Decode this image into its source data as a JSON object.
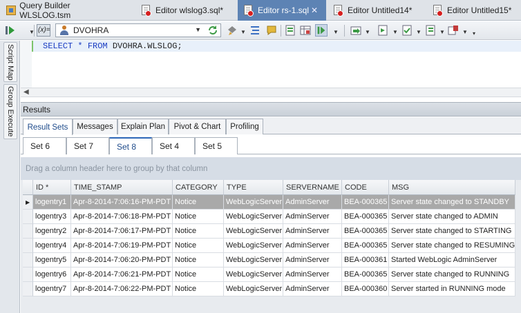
{
  "doc_tabs": [
    {
      "label": "Query Builder WLSLOG.tsm",
      "active": false
    },
    {
      "label": "Editor wlslog3.sql*",
      "active": false
    },
    {
      "label": "Editor rs-1.sql",
      "active": true
    },
    {
      "label": "Editor Untitled14*",
      "active": false
    },
    {
      "label": "Editor Untitled15*",
      "active": false
    }
  ],
  "toolbar": {
    "variables_label": "(x)=",
    "connection": "DVOHRA"
  },
  "side_panel": {
    "tabs": [
      "Script Map",
      "Group Execute"
    ]
  },
  "editor": {
    "sql_keyword_select": "SELECT",
    "sql_star": "*",
    "sql_keyword_from": "FROM",
    "sql_table": "DVOHRA.WLSLOG;"
  },
  "results": {
    "title": "Results",
    "tabs": [
      "Result Sets",
      "Messages",
      "Explain Plan",
      "Pivot & Chart",
      "Profiling"
    ],
    "active_tab": "Result Sets",
    "sets": [
      "Set 6",
      "Set 7",
      "Set 8",
      "Set 4",
      "Set 5"
    ],
    "active_set": "Set 8",
    "group_hint": "Drag a column header here to group by that column"
  },
  "grid": {
    "columns": [
      "ID *",
      "TIME_STAMP",
      "CATEGORY",
      "TYPE",
      "SERVERNAME",
      "CODE",
      "MSG"
    ],
    "rows": [
      [
        "logentry1",
        "Apr-8-2014-7:06:16-PM-PDT",
        "Notice",
        "WebLogicServer",
        "AdminServer",
        "BEA-000365",
        "Server state changed to STANDBY"
      ],
      [
        "logentry3",
        "Apr-8-2014-7:06:18-PM-PDT",
        "Notice",
        "WebLogicServer",
        "AdminServer",
        "BEA-000365",
        "Server state changed to ADMIN"
      ],
      [
        "logentry2",
        "Apr-8-2014-7:06:17-PM-PDT",
        "Notice",
        "WebLogicServer",
        "AdminServer",
        "BEA-000365",
        "Server state changed to STARTING"
      ],
      [
        "logentry4",
        "Apr-8-2014-7:06:19-PM-PDT",
        "Notice",
        "WebLogicServer",
        "AdminServer",
        "BEA-000365",
        "Server state changed to RESUMING"
      ],
      [
        "logentry5",
        "Apr-8-2014-7:06:20-PM-PDT",
        "Notice",
        "WebLogicServer",
        "AdminServer",
        "BEA-000361",
        "Started WebLogic AdminServer"
      ],
      [
        "logentry6",
        "Apr-8-2014-7:06:21-PM-PDT",
        "Notice",
        "WebLogicServer",
        "AdminServer",
        "BEA-000365",
        "Server state changed to RUNNING"
      ],
      [
        "logentry7",
        "Apr-8-2014-7:06:22-PM-PDT",
        "Notice",
        "WebLogicServer",
        "AdminServer",
        "BEA-000360",
        "Server started in RUNNING mode"
      ]
    ],
    "selected_row": 0
  }
}
